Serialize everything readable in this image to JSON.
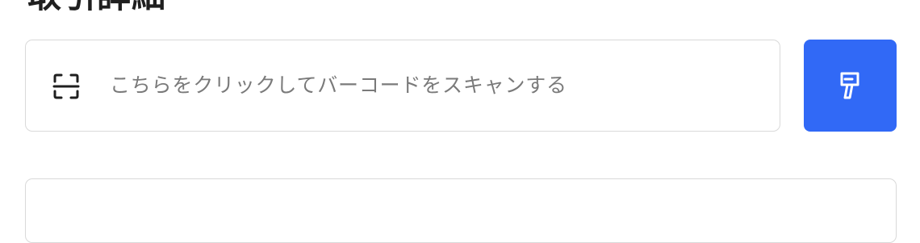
{
  "page": {
    "title": "取引詳細"
  },
  "scan": {
    "placeholder": "こちらをクリックしてバーコードをスキャンする",
    "icon": "barcode-scan-icon"
  },
  "action_button": {
    "icon": "paint-brush-icon",
    "background_color": "#3169f6"
  }
}
